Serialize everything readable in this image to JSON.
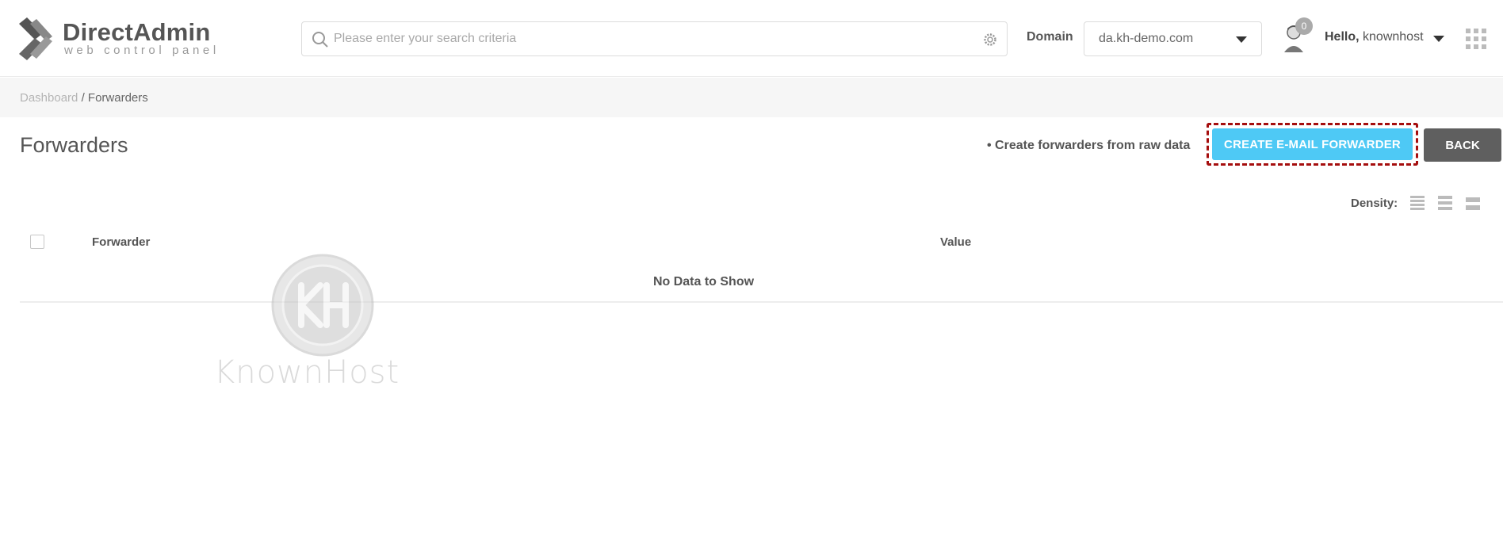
{
  "header": {
    "logo_title": "DirectAdmin",
    "logo_subtitle": "web control panel",
    "search_placeholder": "Please enter your search criteria",
    "domain_label": "Domain",
    "domain_value": "da.kh-demo.com",
    "notification_count": "0",
    "greeting": "Hello,",
    "username": "knownhost"
  },
  "breadcrumb": {
    "root": "Dashboard",
    "separator": "/",
    "current": "Forwarders"
  },
  "page": {
    "title": "Forwarders",
    "raw_data_link": "• Create forwarders from raw data",
    "create_button": "CREATE E-MAIL FORWARDER",
    "back_button": "BACK",
    "density_label": "Density:"
  },
  "table": {
    "columns": [
      "Forwarder",
      "Value"
    ],
    "empty_message": "No Data to Show"
  },
  "watermark": {
    "text": "KnownHost"
  },
  "colors": {
    "primary_button": "#4ec9f5",
    "back_button": "#5f5f5f",
    "highlight_border": "#a50e0e"
  }
}
